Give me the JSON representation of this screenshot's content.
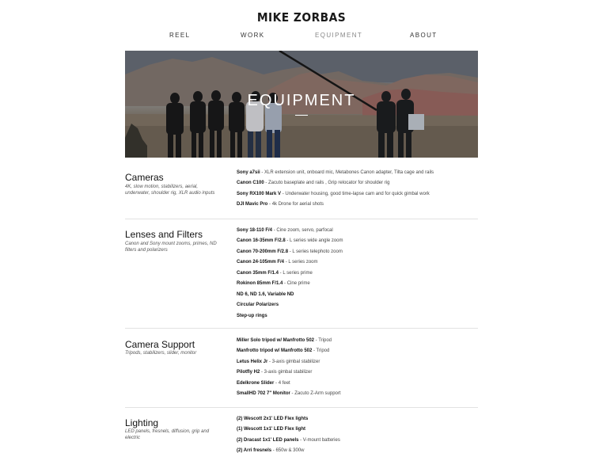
{
  "site": {
    "title": "MIKE ZORBAS"
  },
  "nav": [
    {
      "label": "REEL",
      "active": false
    },
    {
      "label": "WORK",
      "active": false
    },
    {
      "label": "EQUIPMENT",
      "active": true
    },
    {
      "label": "ABOUT",
      "active": false
    }
  ],
  "hero": {
    "title": "EQUIPMENT"
  },
  "sections": [
    {
      "title": "Cameras",
      "description": "4K, slow motion, stabilizers, aerial, underwater, shoulder rig, XLR audio inputs",
      "items": [
        {
          "name": "Sony a7sii",
          "detail": " - XLR extension unit, onboard mic, Metabones Canon adapter, Tilta cage and rails"
        },
        {
          "name": "Canon C100",
          "detail": " - Zacuto baseplate and rails , Grip relocator for shoulder rig"
        },
        {
          "name": "Sony RX100 Mark V",
          "detail": " - Underwater housing, good time-lapse cam and for quick gimbal work"
        },
        {
          "name": "DJI Mavic Pro",
          "detail": " - 4k Drone for aerial shots"
        }
      ]
    },
    {
      "title": "Lenses and Filters",
      "description": "Canon and Sony mount zooms, primes, ND filters and polarizers",
      "items": [
        {
          "name": "Sony 18-110 F/4",
          "detail": " - Cine zoom, servo, parfocal"
        },
        {
          "name": "Canon 16-35mm F/2.8",
          "detail": " - L series wide angle zoom"
        },
        {
          "name": "Canon 70-200mm F/2.8",
          "detail": " - L series telephoto zoom"
        },
        {
          "name": "Canon 24-105mm F/4",
          "detail": " - L series zoom"
        },
        {
          "name": "Canon 35mm F/1.4",
          "detail": " - L series prime"
        },
        {
          "name": "Rokinon 85mm F/1.4",
          "detail": " - Cine prime"
        },
        {
          "name": "ND 6, ND 1.6, Variable ND",
          "detail": ""
        },
        {
          "name": "Circular Polarizers",
          "detail": ""
        },
        {
          "name": "Step-up rings",
          "detail": ""
        }
      ]
    },
    {
      "title": "Camera Support",
      "description": "Tripods, stabilizers, slider, monitor",
      "items": [
        {
          "name": "Miller Solo tripod w/ Manfrotto 502",
          "detail": " - Tripod"
        },
        {
          "name": "Manfrotto tripod w/ Manfrotto 502",
          "detail": " - Tripod"
        },
        {
          "name": "Letus Helix Jr",
          "detail": " - 3-axis gimbal stabilizer"
        },
        {
          "name": "Pilotfly H2",
          "detail": " - 3-axis gimbal stabilizer"
        },
        {
          "name": "Edelkrone Slider",
          "detail": " - 4 feet"
        },
        {
          "name": "SmallHD 702 7\" Monitor",
          "detail": " - Zacuto Z-Arm support"
        }
      ]
    },
    {
      "title": "Lighting",
      "description": "LED panels, fresnels, diffusion, grip and electric",
      "items": [
        {
          "name": "(2) Wescott 2x1' LED Flex lights",
          "detail": ""
        },
        {
          "name": "(1) Wescott 1x1' LED Flex light",
          "detail": ""
        },
        {
          "name": "(2) Dracast 1x1' LED panels",
          "detail": " - V-mount batteries"
        },
        {
          "name": "(2) Arri fresnels",
          "detail": " - 650w & 300w"
        }
      ]
    }
  ]
}
